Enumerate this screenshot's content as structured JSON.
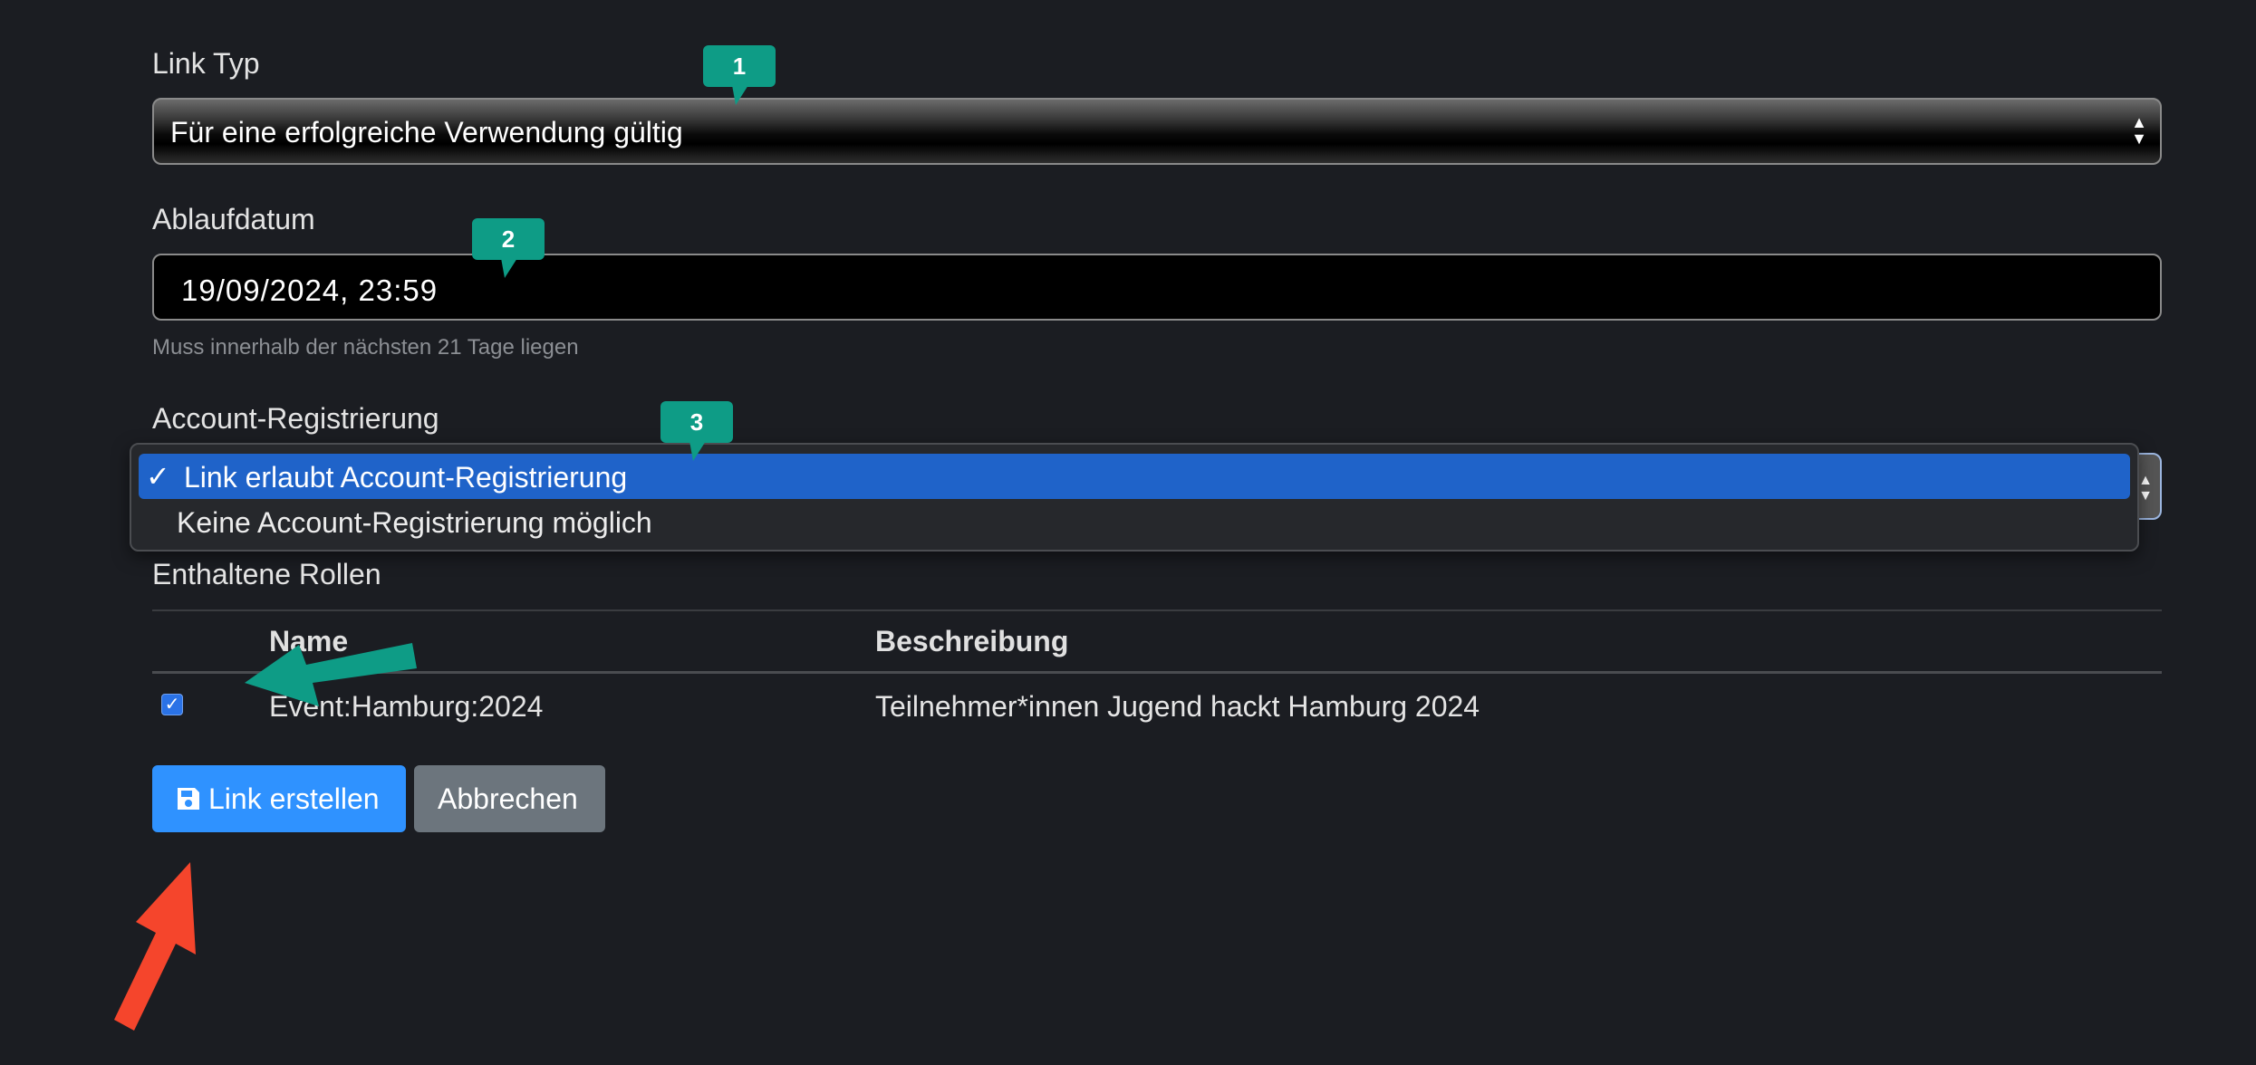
{
  "form": {
    "link_type": {
      "label": "Link Typ",
      "value": "Für eine erfolgreiche Verwendung gültig"
    },
    "expiry": {
      "label": "Ablaufdatum",
      "value": "19/09/2024, 23:59",
      "help": "Muss innerhalb der nächsten 21 Tage liegen"
    },
    "account_registration": {
      "label": "Account-Registrierung",
      "options": [
        {
          "check": "✓",
          "label": "Link erlaubt Account-Registrierung",
          "selected": true
        },
        {
          "label": "Keine Account-Registrierung möglich",
          "selected": false
        }
      ]
    },
    "roles": {
      "label": "Enthaltene Rollen",
      "columns": [
        "Name",
        "Beschreibung"
      ],
      "rows": [
        {
          "checked": true,
          "name": "Event:Hamburg:2024",
          "description": "Teilnehmer*innen Jugend hackt Hamburg 2024"
        }
      ]
    },
    "buttons": {
      "create": "Link erstellen",
      "cancel": "Abbrechen"
    }
  },
  "annotations": {
    "callouts": [
      "1",
      "2",
      "3"
    ],
    "callout_color": "#0e9c86",
    "arrow_teal": "#0e9c86",
    "arrow_red": "#f5452c"
  },
  "colors": {
    "background": "#1b1d22",
    "primary": "#2f92ff",
    "secondary": "#6c757d",
    "highlight": "#1f63c9"
  }
}
